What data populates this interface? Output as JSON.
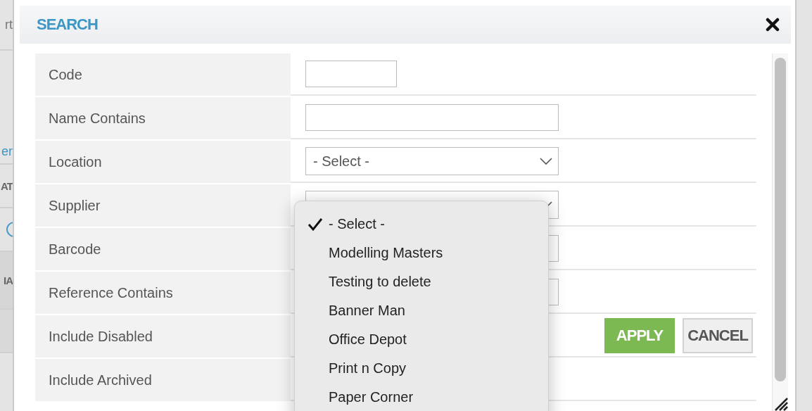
{
  "background": {
    "texts": [
      {
        "text": "rt",
        "kind": "plain"
      },
      {
        "text": "er",
        "kind": "link"
      },
      {
        "text": "AT",
        "kind": "heading"
      },
      {
        "text": "IA",
        "kind": "heading"
      }
    ]
  },
  "dialog": {
    "title": "SEARCH",
    "fields": [
      {
        "label": "Code",
        "kind": "input-short"
      },
      {
        "label": "Name Contains",
        "kind": "input"
      },
      {
        "label": "Location",
        "kind": "select",
        "value": "- Select -"
      },
      {
        "label": "Supplier",
        "kind": "select"
      },
      {
        "label": "Barcode",
        "kind": "input"
      },
      {
        "label": "Reference Contains",
        "kind": "input"
      },
      {
        "label": "Include Disabled",
        "kind": "actions"
      },
      {
        "label": "Include Archived",
        "kind": "none"
      }
    ],
    "buttons": [
      {
        "label": "APPLY",
        "kind": "primary"
      },
      {
        "label": "CANCEL",
        "kind": "secondary"
      }
    ]
  },
  "dropdown": {
    "options": [
      {
        "label": "- Select -",
        "selected": true
      },
      {
        "label": "Modelling Masters",
        "selected": false
      },
      {
        "label": "Testing to delete",
        "selected": false
      },
      {
        "label": "Banner Man",
        "selected": false
      },
      {
        "label": "Office Depot",
        "selected": false
      },
      {
        "label": "Print n Copy",
        "selected": false
      },
      {
        "label": "Paper Corner",
        "selected": false
      }
    ]
  }
}
